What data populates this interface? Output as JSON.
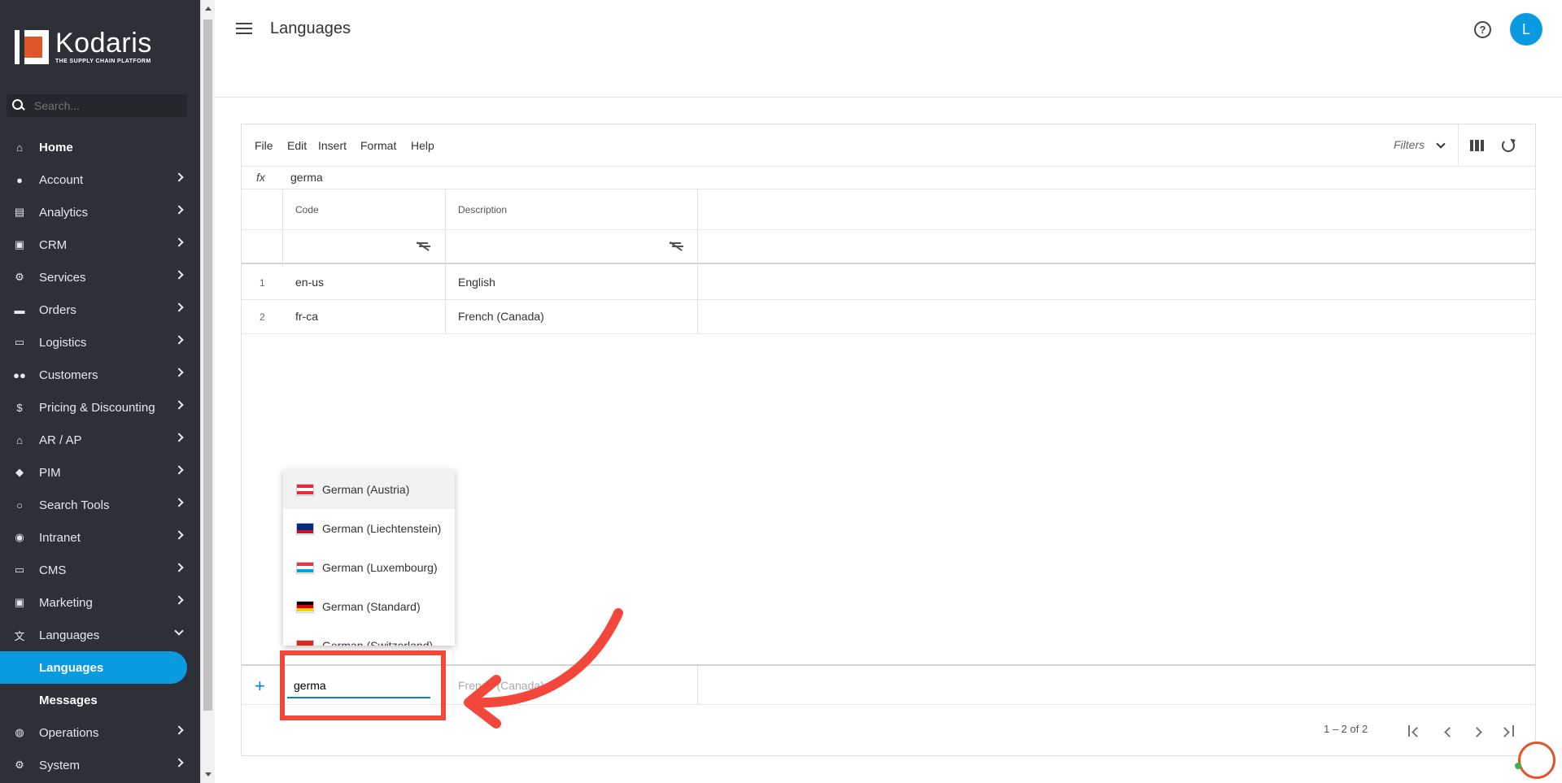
{
  "brand": {
    "name": "Kodaris",
    "tagline": "THE SUPPLY CHAIN PLATFORM",
    "accent": "#0a9ae0",
    "logo_color": "#e0562b"
  },
  "sidebar": {
    "search_placeholder": "Search...",
    "items": [
      {
        "label": "Home",
        "icon": "home-icon"
      },
      {
        "label": "Account",
        "icon": "account-icon"
      },
      {
        "label": "Analytics",
        "icon": "analytics-icon"
      },
      {
        "label": "CRM",
        "icon": "crm-icon"
      },
      {
        "label": "Services",
        "icon": "services-icon"
      },
      {
        "label": "Orders",
        "icon": "truck-icon"
      },
      {
        "label": "Logistics",
        "icon": "logistics-icon"
      },
      {
        "label": "Customers",
        "icon": "customers-icon"
      },
      {
        "label": "Pricing & Discounting",
        "icon": "dollar-icon"
      },
      {
        "label": "AR / AP",
        "icon": "bank-icon"
      },
      {
        "label": "PIM",
        "icon": "tag-icon"
      },
      {
        "label": "Search Tools",
        "icon": "search-icon"
      },
      {
        "label": "Intranet",
        "icon": "intranet-icon"
      },
      {
        "label": "CMS",
        "icon": "cms-icon"
      },
      {
        "label": "Marketing",
        "icon": "marketing-icon"
      },
      {
        "label": "Languages",
        "icon": "translate-icon"
      },
      {
        "label": "Languages",
        "icon": ""
      },
      {
        "label": "Messages",
        "icon": ""
      },
      {
        "label": "Operations",
        "icon": "operations-icon"
      },
      {
        "label": "System",
        "icon": "gear-icon"
      }
    ]
  },
  "header": {
    "title": "Languages",
    "avatar_initial": "L"
  },
  "toolbar": {
    "menu": [
      "File",
      "Edit",
      "Insert",
      "Format",
      "Help"
    ],
    "filters_label": "Filters"
  },
  "formula": {
    "label": "fx",
    "value": "germa"
  },
  "grid": {
    "columns": [
      "Code",
      "Description"
    ],
    "rows": [
      {
        "num": "1",
        "code": "en-us",
        "description": "English"
      },
      {
        "num": "2",
        "code": "fr-ca",
        "description": "French (Canada)"
      }
    ],
    "new_row": {
      "code_value": "germa",
      "description_placeholder": "French (Canada)"
    },
    "pager": "1 – 2 of 2"
  },
  "dropdown": {
    "options": [
      {
        "label": "German (Austria)",
        "flag": [
          "#ed2939",
          "#ffffff",
          "#ed2939"
        ]
      },
      {
        "label": "German (Liechtenstein)",
        "flag": [
          "#002b7f",
          "#002b7f",
          "#ce1126"
        ]
      },
      {
        "label": "German (Luxembourg)",
        "flag": [
          "#ef3340",
          "#ffffff",
          "#00a3e0"
        ]
      },
      {
        "label": "German (Standard)",
        "flag": [
          "#000000",
          "#dd0000",
          "#ffce00"
        ]
      },
      {
        "label": "German (Switzerland)",
        "flag": [
          "#d52b1e",
          "#d52b1e",
          "#d52b1e"
        ]
      }
    ]
  }
}
